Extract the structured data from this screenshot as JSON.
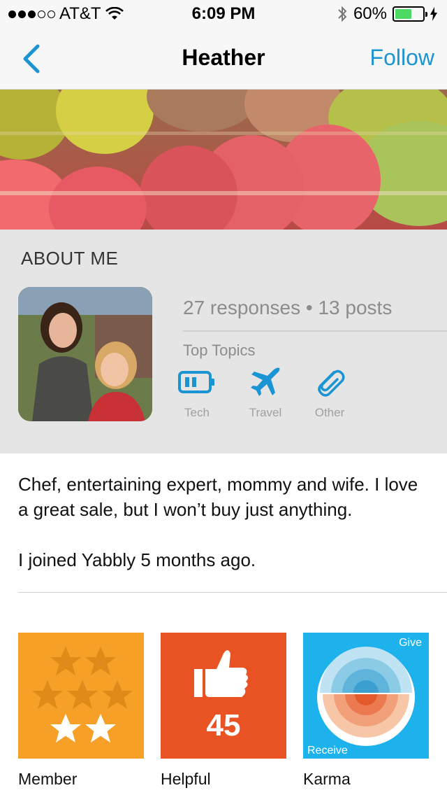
{
  "status_bar": {
    "carrier": "AT&T",
    "time": "6:09 PM",
    "battery_percent": "60%",
    "battery_level": 0.6
  },
  "nav": {
    "title": "Heather",
    "follow_label": "Follow",
    "back_icon": "chevron-left-icon"
  },
  "about": {
    "heading": "ABOUT ME",
    "stats": "27 responses • 13 posts",
    "top_topics_label": "Top Topics",
    "topics": [
      {
        "label": "Tech",
        "icon": "battery-icon"
      },
      {
        "label": "Travel",
        "icon": "airplane-icon"
      },
      {
        "label": "Other",
        "icon": "paperclip-icon"
      }
    ]
  },
  "bio": {
    "text": "Chef, entertaining expert, mommy and wife. I love a great sale, but I won’t buy just anything.",
    "joined": "I joined Yabbly 5 months ago."
  },
  "badges": {
    "member": {
      "label": "Member",
      "stars": 7,
      "filled": 2
    },
    "helpful": {
      "label": "Helpful",
      "count": "45"
    },
    "karma": {
      "label": "Karma",
      "give": "Give",
      "receive": "Receive"
    }
  },
  "colors": {
    "accent": "#1a94d2",
    "member_badge": "#f6a028",
    "helpful_badge": "#e95324",
    "karma_badge": "#1db2ec"
  }
}
